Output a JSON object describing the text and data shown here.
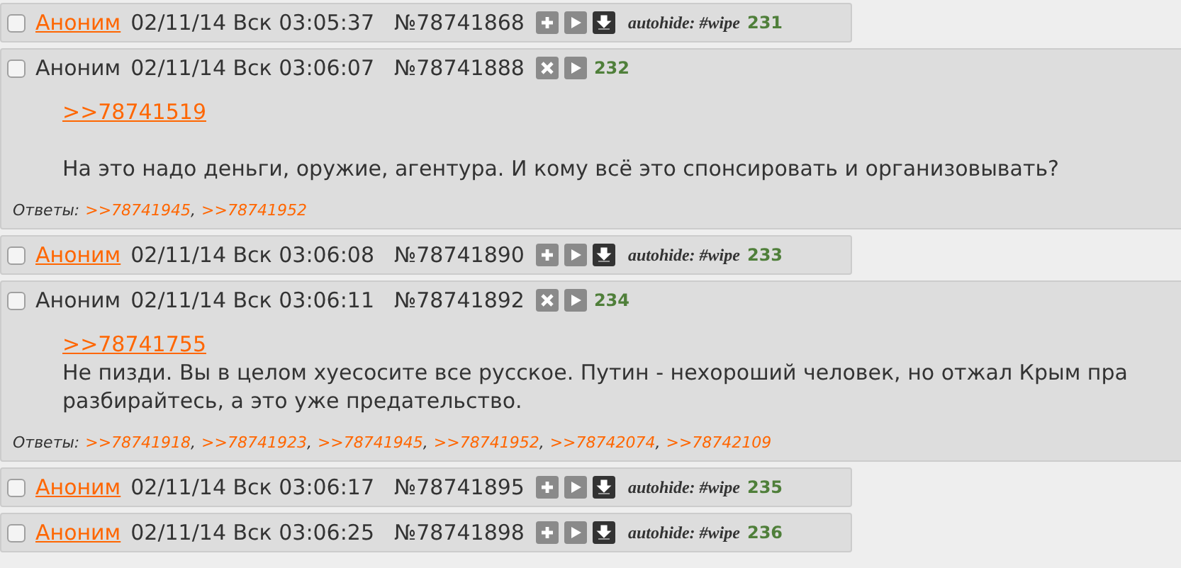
{
  "posts": [
    {
      "kind": "hidden",
      "checked": false,
      "name": "Аноним",
      "date": "02/11/14 Вск 03:05:37",
      "number": "№78741868",
      "autohide": "autohide: #wipe",
      "count": "231"
    },
    {
      "kind": "open",
      "checked": false,
      "name": "Аноним",
      "date": "02/11/14 Вск 03:06:07",
      "number": "№78741888",
      "count": "232",
      "reply_link": ">>78741519",
      "spaced": true,
      "text_lines": [
        "На это надо деньги, оружие, агентура. И кому всё это спонсировать и организовывать?"
      ],
      "replies_label": "Ответы:",
      "separator": ",",
      "replies": [
        ">>78741945",
        ">>78741952"
      ]
    },
    {
      "kind": "hidden",
      "checked": false,
      "name": "Аноним",
      "date": "02/11/14 Вск 03:06:08",
      "number": "№78741890",
      "autohide": "autohide: #wipe",
      "count": "233"
    },
    {
      "kind": "open",
      "checked": false,
      "name": "Аноним",
      "date": "02/11/14 Вск 03:06:11",
      "number": "№78741892",
      "count": "234",
      "reply_link": ">>78741755",
      "spaced": false,
      "text_lines": [
        "Не пизди. Вы в целом хуесосите все русское. Путин - нехороший человек, но отжал Крым пра",
        "разбирайтесь, а это уже предательство."
      ],
      "replies_label": "Ответы:",
      "separator": ",",
      "replies": [
        ">>78741918",
        ">>78741923",
        ">>78741945",
        ">>78741952",
        ">>78742074",
        ">>78742109"
      ]
    },
    {
      "kind": "hidden",
      "checked": false,
      "name": "Аноним",
      "date": "02/11/14 Вск 03:06:17",
      "number": "№78741895",
      "autohide": "autohide: #wipe",
      "count": "235"
    },
    {
      "kind": "hidden",
      "checked": false,
      "name": "Аноним",
      "date": "02/11/14 Вск 03:06:25",
      "number": "№78741898",
      "autohide": "autohide: #wipe",
      "count": "236"
    }
  ]
}
